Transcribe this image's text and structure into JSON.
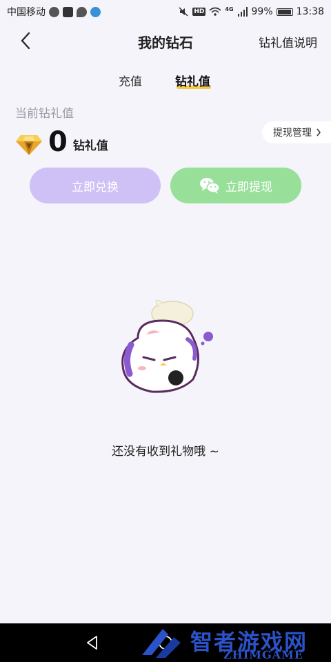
{
  "status_bar": {
    "carrier": "中国移动",
    "network": "4G",
    "hd": "HD",
    "battery": "99%",
    "time": "13:38"
  },
  "header": {
    "title": "我的钻石",
    "right_link": "钻礼值说明"
  },
  "tabs": [
    {
      "label": "充值",
      "active": false
    },
    {
      "label": "钻礼值",
      "active": true
    }
  ],
  "balance": {
    "label": "当前钻礼值",
    "amount": "0",
    "unit": "钻礼值",
    "manage_link": "提现管理"
  },
  "actions": {
    "exchange_label": "立即兑换",
    "withdraw_label": "立即提现"
  },
  "empty_state": {
    "message": "还没有收到礼物哦 ~"
  },
  "watermark": {
    "title": "智者游戏网",
    "subtitle": "ZHIMGAME"
  },
  "colors": {
    "background": "#f4f4fa",
    "tab_underline": "#f7c948",
    "exchange_button": "#cfc1f5",
    "withdraw_button": "#98e09a",
    "watermark": "#2b52c9"
  }
}
